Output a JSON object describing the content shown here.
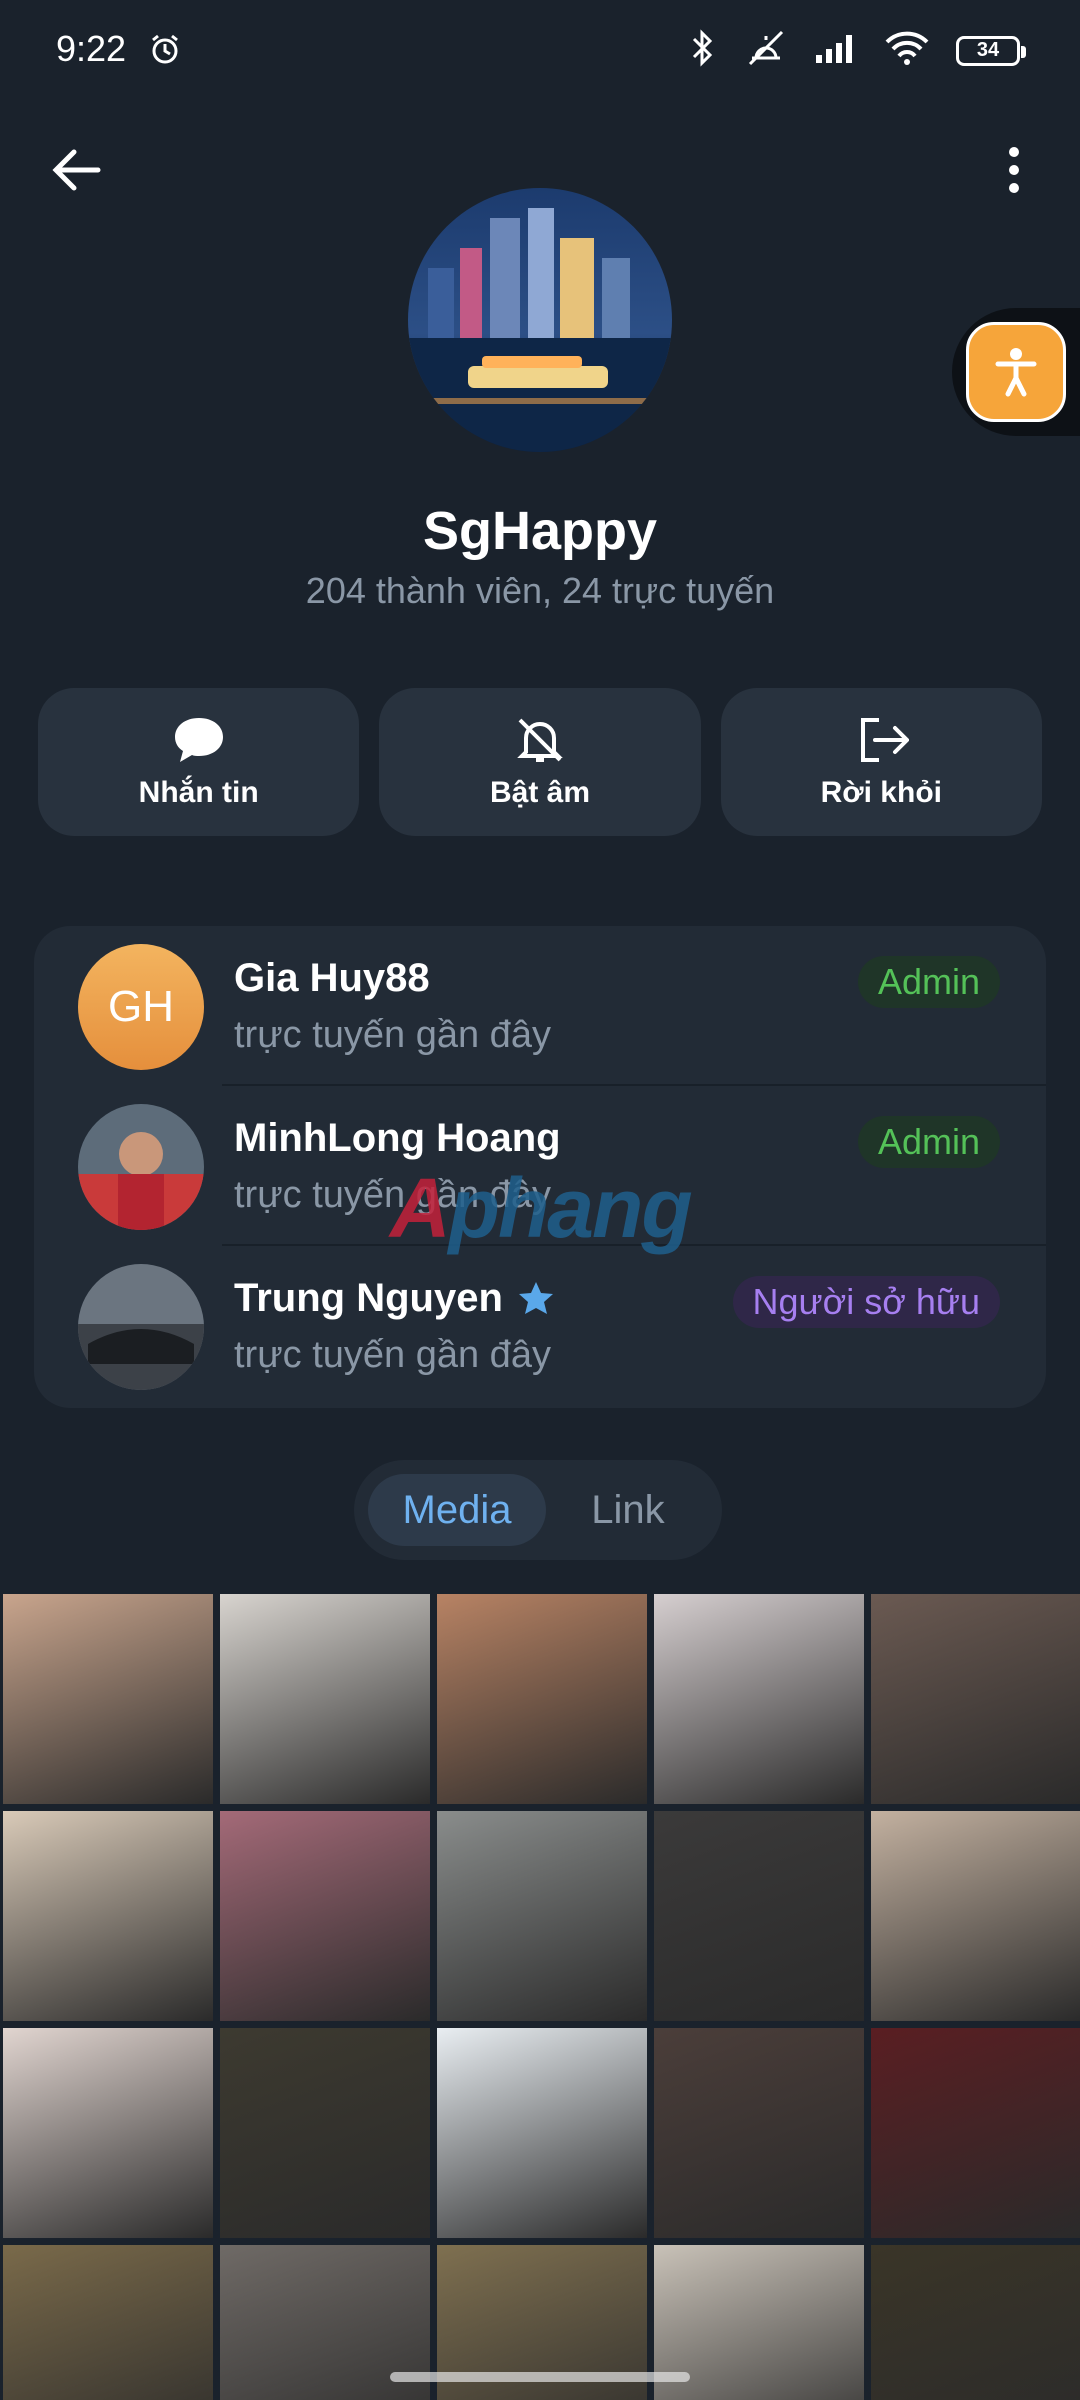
{
  "status_bar": {
    "time": "9:22",
    "battery": "34"
  },
  "chat": {
    "title": "SgHappy",
    "subtitle": "204 thành viên, 24 trực tuyến"
  },
  "actions": [
    {
      "label": "Nhắn tin",
      "icon": "chat-bubble-icon"
    },
    {
      "label": "Bật âm",
      "icon": "bell-muted-icon"
    },
    {
      "label": "Rời khỏi",
      "icon": "leave-icon"
    }
  ],
  "members": [
    {
      "name": "Gia Huy88",
      "status": "trực tuyến gần đây",
      "role": "Admin",
      "initials": "GH"
    },
    {
      "name": "MinhLong Hoang",
      "status": "trực tuyến gần đây",
      "role": "Admin"
    },
    {
      "name": "Trung Nguyen",
      "status": "trực tuyến gần đây",
      "role": "Người sở hữu"
    }
  ],
  "watermark": "Aphang",
  "tabs": {
    "media": "Media",
    "link": "Link"
  },
  "media_tiles": [
    {
      "color": "#c9a58d"
    },
    {
      "color": "#d8d4cf"
    },
    {
      "color": "#b88364"
    },
    {
      "color": "#d6cfd0"
    },
    {
      "color": "#6b5a52"
    },
    {
      "color": "#d9cab8"
    },
    {
      "color": "#a46a78"
    },
    {
      "color": "#8a8d8c"
    },
    {
      "color": "#3b3a3a"
    },
    {
      "color": "#c3b1a0"
    },
    {
      "color": "#e1d5d0"
    },
    {
      "color": "#3d3a30"
    },
    {
      "color": "#e9eef2"
    },
    {
      "color": "#4b3e3a"
    },
    {
      "color": "#5a1e22"
    },
    {
      "color": "#7a6a4a"
    },
    {
      "color": "#6f6a66"
    },
    {
      "color": "#7f7050"
    },
    {
      "color": "#c9c2b8"
    },
    {
      "color": "#3a3528"
    }
  ],
  "colors": {
    "background": "#1a222c",
    "accent": "#6fb1ef",
    "admin": "#54c158",
    "owner": "#a67ff0"
  }
}
